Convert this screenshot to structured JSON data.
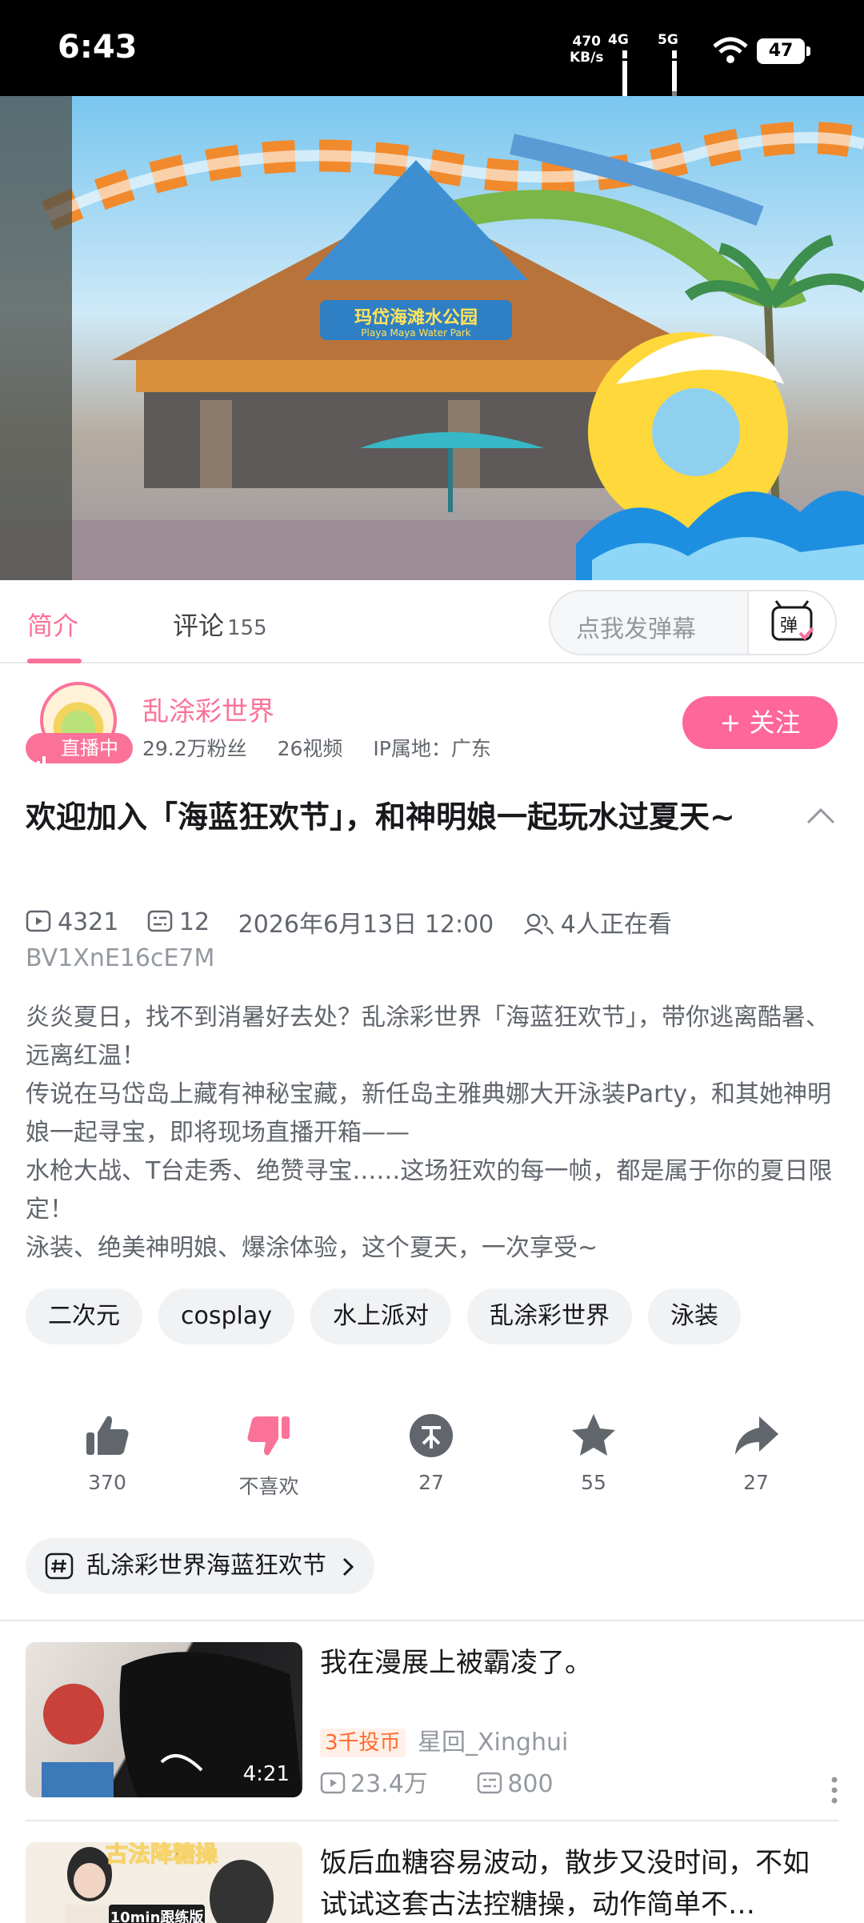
{
  "status_bar": {
    "time": "6:43",
    "speed_value": "470",
    "speed_unit": "KB/s",
    "net1": "4G",
    "net2": "5G",
    "battery": "47"
  },
  "tabs": {
    "intro": "简介",
    "comments": "评论",
    "comments_count": "155",
    "danmaku_placeholder": "点我发弹幕",
    "danmaku_icon_text": "弹"
  },
  "uploader": {
    "name": "乱涂彩世界",
    "live_label": "直播中",
    "fans": "29.2万粉丝",
    "videos": "26视频",
    "ip": "IP属地：广东",
    "follow_label": "+ 关注"
  },
  "video": {
    "title": "欢迎加入「海蓝狂欢节」，和神明娘一起玩水过夏天~",
    "plays": "4321",
    "danmaku_count": "12",
    "date": "2026年6月13日 12:00",
    "watching": "4人正在看",
    "bvid": "BV1XnE16cE7M",
    "description": [
      "炎炎夏日，找不到消暑好去处？乱涂彩世界「海蓝狂欢节」，带你逃离酷暑、远离红温！",
      "传说在马岱岛上藏有神秘宝藏，新任岛主雅典娜大开泳装Party，和其她神明娘一起寻宝，即将现场直播开箱——",
      "水枪大战、T台走秀、绝赞寻宝……这场狂欢的每一帧，都是属于你的夏日限定！",
      "泳装、绝美神明娘、爆涂体验，这个夏天，一次享受~"
    ],
    "tags": [
      "二次元",
      "cosplay",
      "水上派对",
      "乱涂彩世界",
      "泳装"
    ],
    "sign_text": "玛岱海滩水公园",
    "sign_subtext": "Playa Maya Water Park"
  },
  "actions": {
    "like": "370",
    "dislike": "不喜欢",
    "coin": "27",
    "favorite": "55",
    "share": "27"
  },
  "topic": "乱涂彩世界海蓝狂欢节",
  "recommended": [
    {
      "title": "我在漫展上被霸凌了。",
      "duration": "4:21",
      "coin_badge": "3千投币",
      "author": "星回_Xinghui",
      "views": "23.4万",
      "danmaku": "800"
    },
    {
      "title": "饭后血糖容易波动，散步又没时间，不如试试这套古法控糖操，动作简单不…",
      "thumb_text": "古法降糖操",
      "thumb_subtext": "10min跟练版"
    }
  ],
  "colors": {
    "accent": "#fb7299",
    "follow": "#ff6699",
    "coin_badge": "#ff6a2d"
  }
}
